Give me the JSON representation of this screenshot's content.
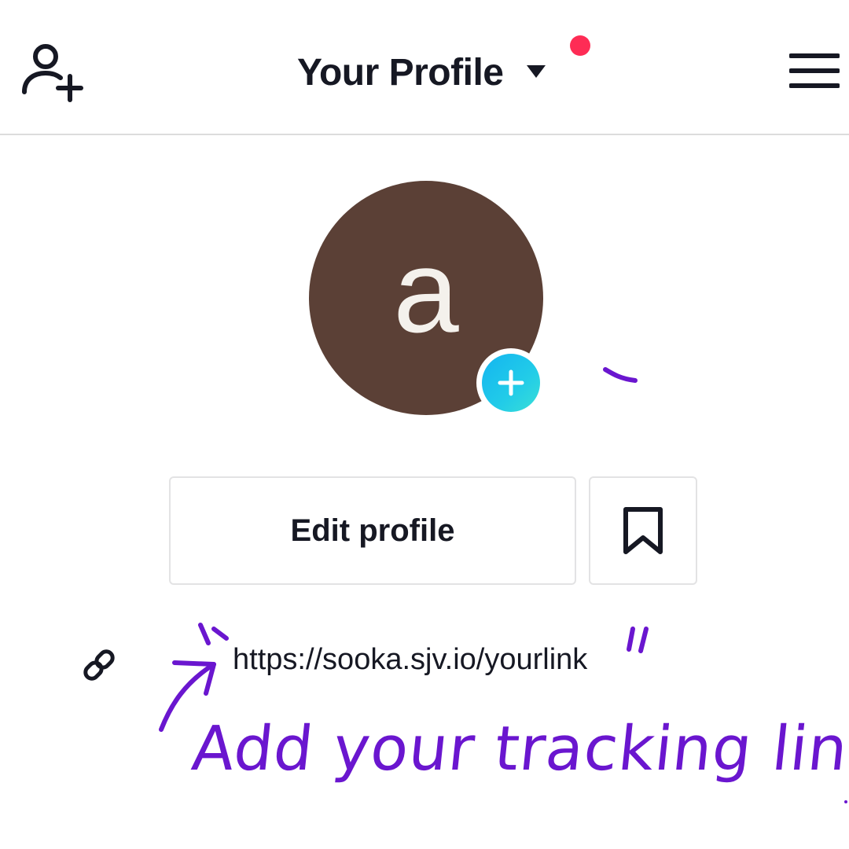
{
  "header": {
    "title": "Your Profile",
    "add_user_icon": "person-plus-icon",
    "menu_icon": "hamburger-menu-icon",
    "notification_dot_color": "#fe2c55"
  },
  "avatar": {
    "letter": "a",
    "background_color": "#5b4036",
    "add_photo_icon": "plus-icon"
  },
  "actions": {
    "edit_profile_label": "Edit profile",
    "bookmark_icon": "bookmark-icon"
  },
  "bio_link": {
    "icon": "link-icon",
    "url": "https://sooka.sjv.io/yourlink"
  },
  "annotation": {
    "text": "Add your tracking link",
    "color": "#6a16cf"
  }
}
